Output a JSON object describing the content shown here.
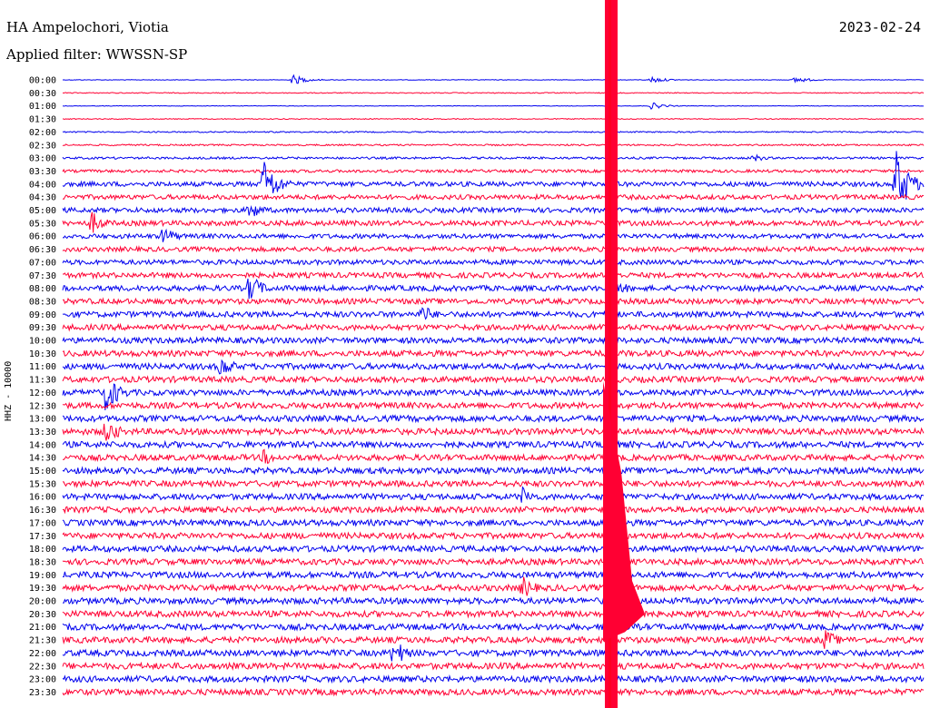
{
  "header": {
    "station": "HA Ampelochori, Viotia",
    "date": "2023-02-24",
    "filter": "Applied filter: WWSSN-SP",
    "channel": "HHZ - 10000"
  },
  "colors": {
    "even_row": "#0000ee",
    "odd_row": "#ff0033"
  },
  "chart_data": {
    "type": "line",
    "title": "HA Ampelochori, Viotia",
    "subtitle": "Applied filter: WWSSN-SP",
    "ylabel": "HHZ - 10000",
    "row_labels": [
      "00:00",
      "00:30",
      "01:00",
      "01:30",
      "02:00",
      "02:30",
      "03:00",
      "03:30",
      "04:00",
      "04:30",
      "05:00",
      "05:30",
      "06:00",
      "06:30",
      "07:00",
      "07:30",
      "08:00",
      "08:30",
      "09:00",
      "09:30",
      "10:00",
      "10:30",
      "11:00",
      "11:30",
      "12:00",
      "12:30",
      "13:00",
      "13:30",
      "14:00",
      "14:30",
      "15:00",
      "15:30",
      "16:00",
      "16:30",
      "17:00",
      "17:30",
      "18:00",
      "18:30",
      "19:00",
      "19:30",
      "20:00",
      "20:30",
      "21:00",
      "21:30",
      "22:00",
      "22:30",
      "23:00",
      "23:30"
    ],
    "row_noise_level": [
      0.3,
      0.5,
      0.3,
      0.5,
      0.7,
      0.9,
      1.2,
      1.6,
      2.6,
      2.6,
      2.7,
      2.8,
      2.5,
      2.6,
      2.7,
      2.9,
      3.0,
      3.0,
      3.1,
      3.1,
      3.2,
      3.3,
      3.3,
      3.3,
      3.2,
      3.3,
      3.4,
      3.4,
      3.4,
      3.3,
      3.4,
      3.3,
      3.3,
      3.3,
      3.3,
      3.3,
      3.3,
      3.3,
      3.4,
      3.4,
      3.4,
      3.4,
      3.4,
      3.4,
      3.4,
      3.4,
      3.4,
      3.3
    ],
    "events": [
      {
        "row": 0,
        "x_min": 8.0,
        "amplitude": 6
      },
      {
        "row": 0,
        "x_min": 20.5,
        "amplitude": 4
      },
      {
        "row": 0,
        "x_min": 25.5,
        "amplitude": 4
      },
      {
        "row": 2,
        "x_min": 20.5,
        "amplitude": 4
      },
      {
        "row": 6,
        "x_min": 24.0,
        "amplitude": 5
      },
      {
        "row": 8,
        "x_min": 7.0,
        "amplitude": 30
      },
      {
        "row": 8,
        "x_min": 29.0,
        "amplitude": 40
      },
      {
        "row": 10,
        "x_min": 6.5,
        "amplitude": 12
      },
      {
        "row": 11,
        "x_min": 1.0,
        "amplitude": 14
      },
      {
        "row": 12,
        "x_min": 3.5,
        "amplitude": 12
      },
      {
        "row": 16,
        "x_min": 6.5,
        "amplitude": 18
      },
      {
        "row": 16,
        "x_min": 19.0,
        "amplitude": 18
      },
      {
        "row": 18,
        "x_min": 12.5,
        "amplitude": 12
      },
      {
        "row": 22,
        "x_min": 5.5,
        "amplitude": 14
      },
      {
        "row": 24,
        "x_min": 1.5,
        "amplitude": 24
      },
      {
        "row": 27,
        "x_min": 1.5,
        "amplitude": 16
      },
      {
        "row": 29,
        "x_min": 7.0,
        "amplitude": 10
      },
      {
        "row": 32,
        "x_min": 16.0,
        "amplitude": 12
      },
      {
        "row": 39,
        "x_min": 16.0,
        "amplitude": 14
      },
      {
        "row": 44,
        "x_min": 11.5,
        "amplitude": 18
      },
      {
        "row": 43,
        "x_min": 26.5,
        "amplitude": 14
      }
    ],
    "large_event": {
      "start_row": 0,
      "x_min": 19.0,
      "decay_end_row": 41,
      "saturated": true
    },
    "xlim": [
      0,
      30
    ]
  }
}
